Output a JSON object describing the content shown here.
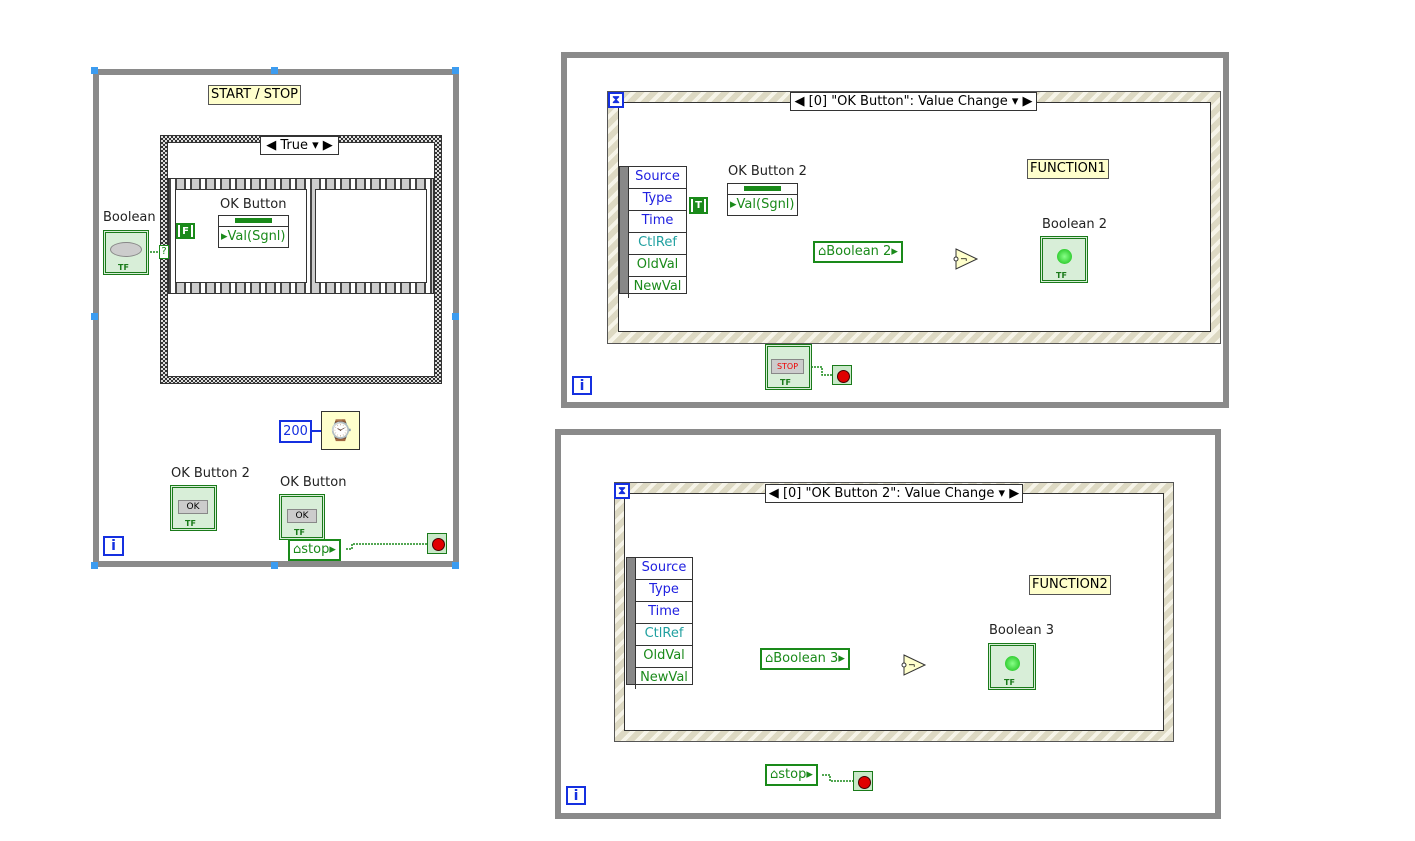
{
  "loop1": {
    "comment": "START / STOP",
    "case_selector": "True",
    "boolean_label": "Boolean",
    "false_constant": "F",
    "ok_button_prop_label": "OK Button",
    "prop_value": "Val(Sgnl)",
    "wait_ms": "200",
    "ok_button2_label": "OK Button 2",
    "ok_button_label": "OK Button",
    "ok_text": "OK",
    "stop_local": "stop",
    "tf": "TF",
    "iteration": "i",
    "case_tunnel": "?"
  },
  "loop2": {
    "event_selector": "[0] \"OK Button\": Value Change",
    "event_fields": [
      "Source",
      "Type",
      "Time",
      "CtlRef",
      "OldVal",
      "NewVal"
    ],
    "true_constant": "T",
    "prop_label": "OK Button 2",
    "prop_value": "Val(Sgnl)",
    "comment": "FUNCTION1",
    "local": "Boolean 2",
    "indicator_label": "Boolean 2",
    "stop_button_text": "STOP",
    "tf": "TF",
    "iteration": "i"
  },
  "loop3": {
    "event_selector": "[0] \"OK Button 2\": Value Change",
    "event_fields": [
      "Source",
      "Type",
      "Time",
      "CtlRef",
      "OldVal",
      "NewVal"
    ],
    "comment": "FUNCTION2",
    "local": "Boolean 3",
    "indicator_label": "Boolean 3",
    "stop_local": "stop",
    "tf": "TF",
    "iteration": "i"
  },
  "colors": {
    "boolean_wire": "#1a8a1a",
    "numeric": "#1530e0",
    "loop_frame": "#8a8a8a",
    "comment_bg": "#ffffcc"
  }
}
